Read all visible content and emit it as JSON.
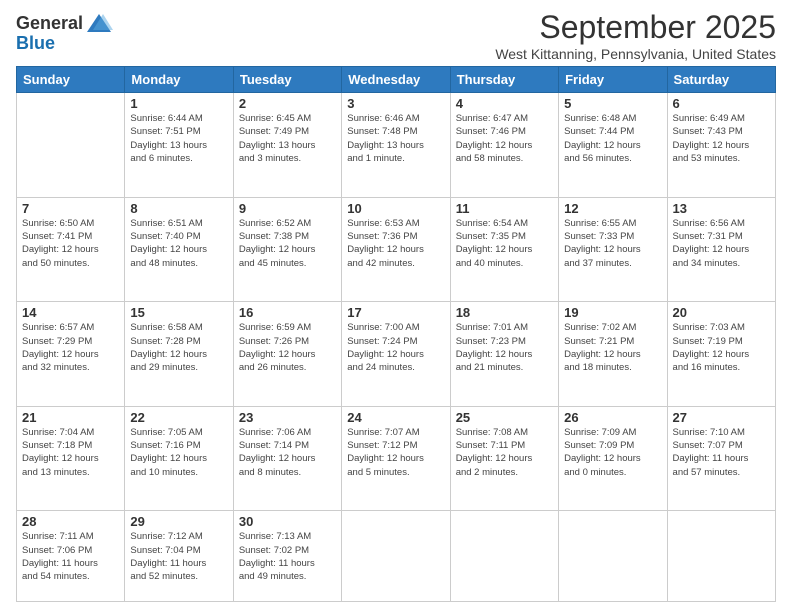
{
  "header": {
    "logo_general": "General",
    "logo_blue": "Blue",
    "month": "September 2025",
    "location": "West Kittanning, Pennsylvania, United States"
  },
  "days_of_week": [
    "Sunday",
    "Monday",
    "Tuesday",
    "Wednesday",
    "Thursday",
    "Friday",
    "Saturday"
  ],
  "weeks": [
    [
      {
        "day": "",
        "info": ""
      },
      {
        "day": "1",
        "info": "Sunrise: 6:44 AM\nSunset: 7:51 PM\nDaylight: 13 hours\nand 6 minutes."
      },
      {
        "day": "2",
        "info": "Sunrise: 6:45 AM\nSunset: 7:49 PM\nDaylight: 13 hours\nand 3 minutes."
      },
      {
        "day": "3",
        "info": "Sunrise: 6:46 AM\nSunset: 7:48 PM\nDaylight: 13 hours\nand 1 minute."
      },
      {
        "day": "4",
        "info": "Sunrise: 6:47 AM\nSunset: 7:46 PM\nDaylight: 12 hours\nand 58 minutes."
      },
      {
        "day": "5",
        "info": "Sunrise: 6:48 AM\nSunset: 7:44 PM\nDaylight: 12 hours\nand 56 minutes."
      },
      {
        "day": "6",
        "info": "Sunrise: 6:49 AM\nSunset: 7:43 PM\nDaylight: 12 hours\nand 53 minutes."
      }
    ],
    [
      {
        "day": "7",
        "info": "Sunrise: 6:50 AM\nSunset: 7:41 PM\nDaylight: 12 hours\nand 50 minutes."
      },
      {
        "day": "8",
        "info": "Sunrise: 6:51 AM\nSunset: 7:40 PM\nDaylight: 12 hours\nand 48 minutes."
      },
      {
        "day": "9",
        "info": "Sunrise: 6:52 AM\nSunset: 7:38 PM\nDaylight: 12 hours\nand 45 minutes."
      },
      {
        "day": "10",
        "info": "Sunrise: 6:53 AM\nSunset: 7:36 PM\nDaylight: 12 hours\nand 42 minutes."
      },
      {
        "day": "11",
        "info": "Sunrise: 6:54 AM\nSunset: 7:35 PM\nDaylight: 12 hours\nand 40 minutes."
      },
      {
        "day": "12",
        "info": "Sunrise: 6:55 AM\nSunset: 7:33 PM\nDaylight: 12 hours\nand 37 minutes."
      },
      {
        "day": "13",
        "info": "Sunrise: 6:56 AM\nSunset: 7:31 PM\nDaylight: 12 hours\nand 34 minutes."
      }
    ],
    [
      {
        "day": "14",
        "info": "Sunrise: 6:57 AM\nSunset: 7:29 PM\nDaylight: 12 hours\nand 32 minutes."
      },
      {
        "day": "15",
        "info": "Sunrise: 6:58 AM\nSunset: 7:28 PM\nDaylight: 12 hours\nand 29 minutes."
      },
      {
        "day": "16",
        "info": "Sunrise: 6:59 AM\nSunset: 7:26 PM\nDaylight: 12 hours\nand 26 minutes."
      },
      {
        "day": "17",
        "info": "Sunrise: 7:00 AM\nSunset: 7:24 PM\nDaylight: 12 hours\nand 24 minutes."
      },
      {
        "day": "18",
        "info": "Sunrise: 7:01 AM\nSunset: 7:23 PM\nDaylight: 12 hours\nand 21 minutes."
      },
      {
        "day": "19",
        "info": "Sunrise: 7:02 AM\nSunset: 7:21 PM\nDaylight: 12 hours\nand 18 minutes."
      },
      {
        "day": "20",
        "info": "Sunrise: 7:03 AM\nSunset: 7:19 PM\nDaylight: 12 hours\nand 16 minutes."
      }
    ],
    [
      {
        "day": "21",
        "info": "Sunrise: 7:04 AM\nSunset: 7:18 PM\nDaylight: 12 hours\nand 13 minutes."
      },
      {
        "day": "22",
        "info": "Sunrise: 7:05 AM\nSunset: 7:16 PM\nDaylight: 12 hours\nand 10 minutes."
      },
      {
        "day": "23",
        "info": "Sunrise: 7:06 AM\nSunset: 7:14 PM\nDaylight: 12 hours\nand 8 minutes."
      },
      {
        "day": "24",
        "info": "Sunrise: 7:07 AM\nSunset: 7:12 PM\nDaylight: 12 hours\nand 5 minutes."
      },
      {
        "day": "25",
        "info": "Sunrise: 7:08 AM\nSunset: 7:11 PM\nDaylight: 12 hours\nand 2 minutes."
      },
      {
        "day": "26",
        "info": "Sunrise: 7:09 AM\nSunset: 7:09 PM\nDaylight: 12 hours\nand 0 minutes."
      },
      {
        "day": "27",
        "info": "Sunrise: 7:10 AM\nSunset: 7:07 PM\nDaylight: 11 hours\nand 57 minutes."
      }
    ],
    [
      {
        "day": "28",
        "info": "Sunrise: 7:11 AM\nSunset: 7:06 PM\nDaylight: 11 hours\nand 54 minutes."
      },
      {
        "day": "29",
        "info": "Sunrise: 7:12 AM\nSunset: 7:04 PM\nDaylight: 11 hours\nand 52 minutes."
      },
      {
        "day": "30",
        "info": "Sunrise: 7:13 AM\nSunset: 7:02 PM\nDaylight: 11 hours\nand 49 minutes."
      },
      {
        "day": "",
        "info": ""
      },
      {
        "day": "",
        "info": ""
      },
      {
        "day": "",
        "info": ""
      },
      {
        "day": "",
        "info": ""
      }
    ]
  ]
}
